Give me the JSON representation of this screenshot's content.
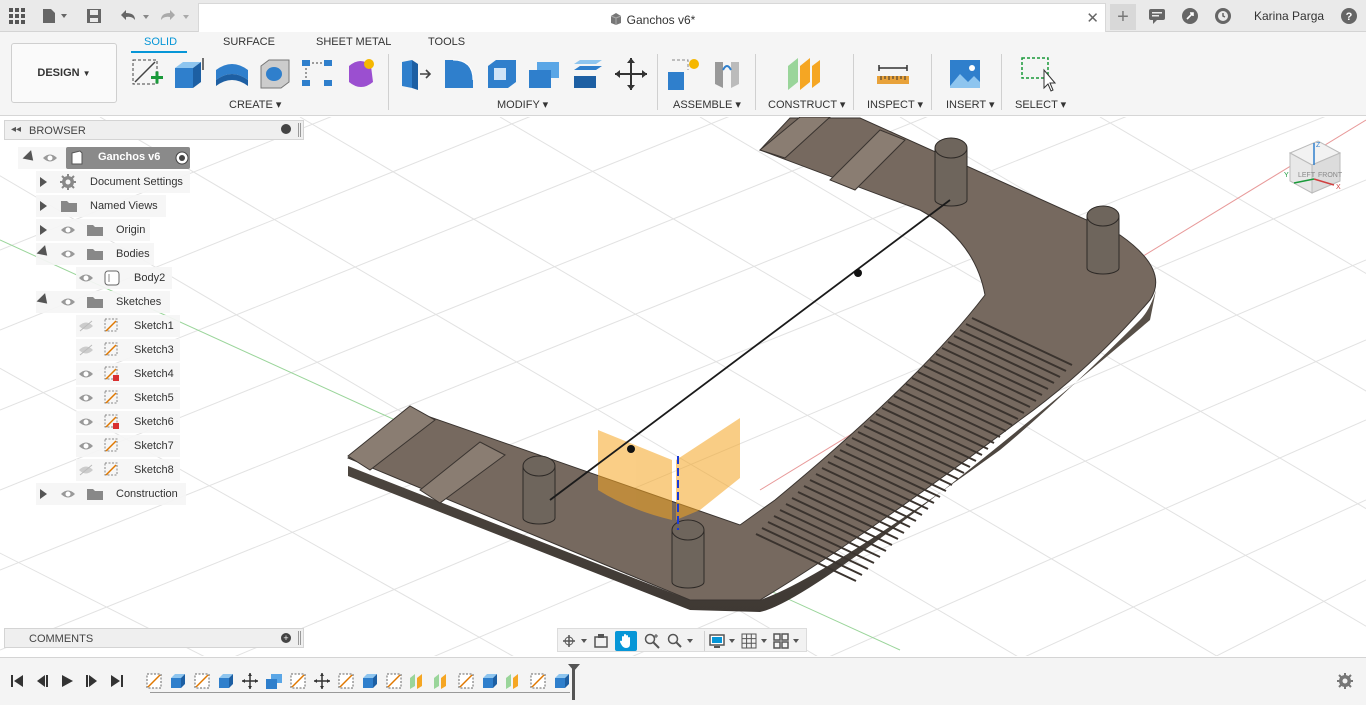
{
  "titlebar": {
    "doc_title": "Ganchos v6*",
    "user_name": "Karina Parga"
  },
  "toolbar": {
    "workspace_button": "DESIGN",
    "tabs": [
      "SOLID",
      "SURFACE",
      "SHEET METAL",
      "TOOLS"
    ],
    "groups": {
      "create": "CREATE",
      "modify": "MODIFY",
      "assemble": "ASSEMBLE",
      "construct": "CONSTRUCT",
      "inspect": "INSPECT",
      "insert": "INSERT",
      "select": "SELECT"
    }
  },
  "browser": {
    "header": "BROWSER",
    "root": "Ganchos v6",
    "items": {
      "document_settings": "Document Settings",
      "named_views": "Named Views",
      "origin": "Origin",
      "bodies": "Bodies",
      "body2": "Body2",
      "sketches": "Sketches",
      "construction": "Construction"
    },
    "sketches": [
      "Sketch1",
      "Sketch3",
      "Sketch4",
      "Sketch5",
      "Sketch6",
      "Sketch7",
      "Sketch8"
    ]
  },
  "comments": {
    "header": "COMMENTS"
  },
  "viewcube": {
    "left": "LEFT",
    "front": "FRONT",
    "axis_z": "Z",
    "axis_x": "X",
    "axis_y": "Y"
  },
  "colors": {
    "accent": "#0696d7",
    "body": "#6f665d",
    "body_top": "#7b7268",
    "construction_plane": "#f5a623"
  }
}
